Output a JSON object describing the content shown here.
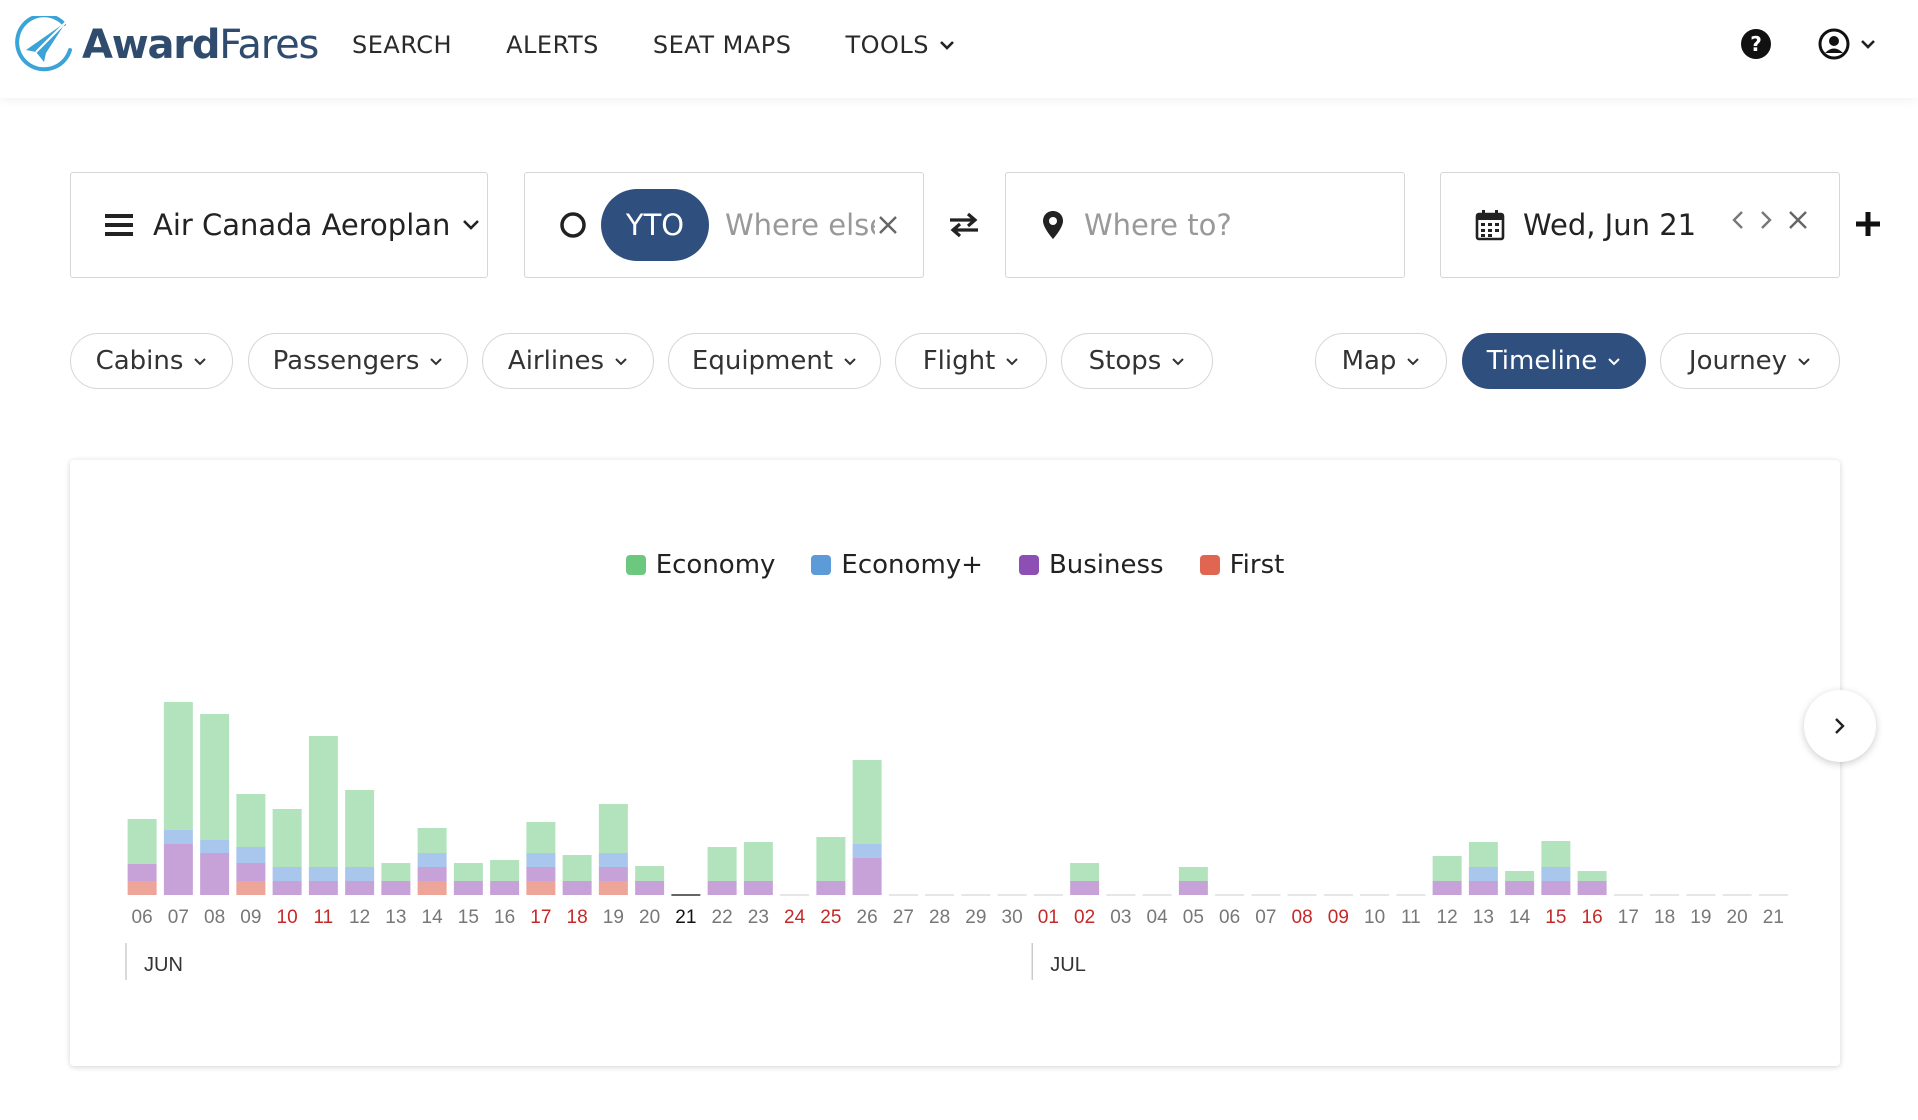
{
  "header": {
    "logo_bold": "Award",
    "logo_regular": "Fares",
    "nav": [
      {
        "label": "SEARCH"
      },
      {
        "label": "ALERTS"
      },
      {
        "label": "SEAT MAPS"
      },
      {
        "label": "TOOLS"
      }
    ]
  },
  "search": {
    "program": "Air Canada Aeroplan",
    "origin_code": "YTO",
    "origin_placeholder": "Where else?",
    "destination_placeholder": "Where to?",
    "date": "Wed, Jun 21"
  },
  "filters": [
    "Cabins",
    "Passengers",
    "Airlines",
    "Equipment",
    "Flight",
    "Stops"
  ],
  "views": [
    {
      "label": "Map",
      "active": false
    },
    {
      "label": "Timeline",
      "active": true
    },
    {
      "label": "Journey",
      "active": false
    }
  ],
  "colors": {
    "brand": "#2f4f7f",
    "economy": "#b2e3bd",
    "economy_plus": "#a9c7ec",
    "business": "#c7a2d8",
    "first": "#eda59a",
    "weekend_label": "#c62828",
    "legend_economy": "#6cc77f",
    "legend_economy_plus": "#5d9ad8",
    "legend_business": "#8e4fb5",
    "legend_first": "#e06652"
  },
  "chart_data": {
    "type": "bar",
    "stacked": true,
    "legend": [
      "Economy",
      "Economy+",
      "Business",
      "First"
    ],
    "legend_position": "top-center",
    "months": [
      {
        "label": "JUN",
        "start_index": 0
      },
      {
        "label": "JUL",
        "start_index": 25
      }
    ],
    "categories": [
      "06",
      "07",
      "08",
      "09",
      "10",
      "11",
      "12",
      "13",
      "14",
      "15",
      "16",
      "17",
      "18",
      "19",
      "20",
      "21",
      "22",
      "23",
      "24",
      "25",
      "26",
      "27",
      "28",
      "29",
      "30",
      "01",
      "02",
      "03",
      "04",
      "05",
      "06",
      "07",
      "08",
      "09",
      "10",
      "11",
      "12",
      "13",
      "14",
      "15",
      "16",
      "17",
      "18",
      "19",
      "20",
      "21"
    ],
    "weekend": [
      false,
      false,
      false,
      false,
      true,
      true,
      false,
      false,
      false,
      false,
      false,
      true,
      true,
      false,
      false,
      false,
      false,
      false,
      true,
      true,
      false,
      false,
      false,
      false,
      false,
      true,
      true,
      false,
      false,
      false,
      false,
      false,
      true,
      true,
      false,
      false,
      false,
      false,
      false,
      true,
      true,
      false,
      false,
      false,
      false,
      false
    ],
    "selected_index": 15,
    "series": [
      {
        "name": "Economy",
        "values": [
          45,
          128,
          126,
          53,
          58,
          131,
          77,
          18,
          25,
          18,
          21,
          31,
          26,
          49,
          15,
          0,
          34,
          39,
          0,
          44,
          84,
          0,
          0,
          0,
          0,
          0,
          18,
          0,
          0,
          14,
          0,
          0,
          0,
          0,
          0,
          0,
          25,
          25,
          10,
          26,
          10,
          0,
          0,
          0,
          0,
          0
        ]
      },
      {
        "name": "Economy+",
        "values": [
          0,
          14,
          13,
          16,
          14,
          14,
          14,
          0,
          14,
          0,
          0,
          14,
          0,
          14,
          0,
          0,
          0,
          0,
          0,
          0,
          14,
          0,
          0,
          0,
          0,
          0,
          0,
          0,
          0,
          0,
          0,
          0,
          0,
          0,
          0,
          0,
          0,
          14,
          0,
          14,
          0,
          0,
          0,
          0,
          0,
          0
        ]
      },
      {
        "name": "Business",
        "values": [
          17,
          51,
          42,
          18,
          14,
          14,
          14,
          14,
          14,
          14,
          14,
          14,
          14,
          14,
          14,
          0,
          14,
          14,
          0,
          14,
          37,
          0,
          0,
          0,
          0,
          0,
          14,
          0,
          0,
          14,
          0,
          0,
          0,
          0,
          0,
          0,
          14,
          14,
          14,
          14,
          14,
          0,
          0,
          0,
          0,
          0
        ]
      },
      {
        "name": "First",
        "values": [
          14,
          0,
          0,
          14,
          0,
          0,
          0,
          0,
          14,
          0,
          0,
          14,
          0,
          14,
          0,
          0,
          0,
          0,
          0,
          0,
          0,
          0,
          0,
          0,
          0,
          0,
          0,
          0,
          0,
          0,
          0,
          0,
          0,
          0,
          0,
          0,
          0,
          0,
          0,
          0,
          0,
          0,
          0,
          0,
          0,
          0
        ]
      }
    ]
  }
}
